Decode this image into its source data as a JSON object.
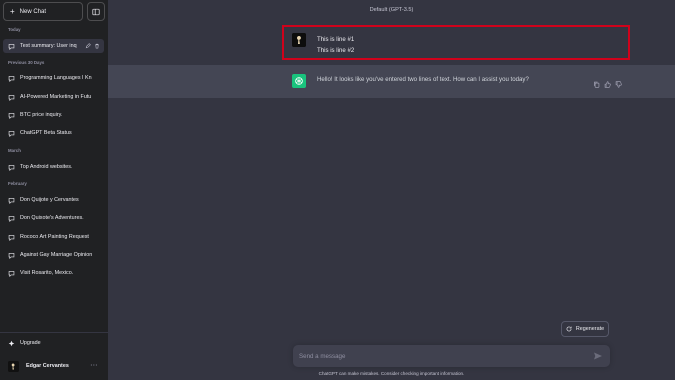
{
  "sidebar": {
    "new_chat_label": "New Chat",
    "sections": {
      "today": "Today",
      "previous_30": "Previous 30 Days",
      "march": "March",
      "february": "February"
    },
    "chats": [
      {
        "label": "Text summary: User inq",
        "active": true
      },
      {
        "label": "Programming Languages I Kn"
      },
      {
        "label": "AI-Powered Marketing in Futu"
      },
      {
        "label": "BTC price inquiry."
      },
      {
        "label": "ChatGPT Beta Status"
      },
      {
        "label": "Top Android websites."
      },
      {
        "label": "Don Quijote y Cervantes"
      },
      {
        "label": "Don Quixote's Adventures."
      },
      {
        "label": "Rococo Art Painting Request"
      },
      {
        "label": "Against Gay Marriage Opinion"
      },
      {
        "label": "Visit Rosarito, Mexico."
      }
    ],
    "upgrade_label": "Upgrade",
    "user_name": "Edgar Cervantes",
    "more_label": "···"
  },
  "main": {
    "model_title": "Default (GPT-3.5)",
    "user_message": {
      "line1": "This is line #1",
      "line2": "This is line #2"
    },
    "assistant_message": "Hello! It looks like you've entered two lines of text. How can I assist you today?",
    "regenerate_label": "Regenerate",
    "input_placeholder": "Send a message",
    "disclaimer": "ChatGPT can make mistakes. Consider checking important information."
  },
  "colors": {
    "sidebar_bg": "#202123",
    "main_bg": "#343541",
    "assistant_bg": "#444654",
    "gpt_green": "#19c37d",
    "highlight_red": "#d0021b"
  },
  "icons": [
    "plus-icon",
    "sidebar-toggle-icon",
    "chat-bubble-icon",
    "edit-icon",
    "trash-icon",
    "upgrade-icon",
    "more-icon",
    "gpt-logo-icon",
    "copy-icon",
    "thumbs-up-icon",
    "thumbs-down-icon",
    "refresh-icon",
    "send-icon"
  ]
}
